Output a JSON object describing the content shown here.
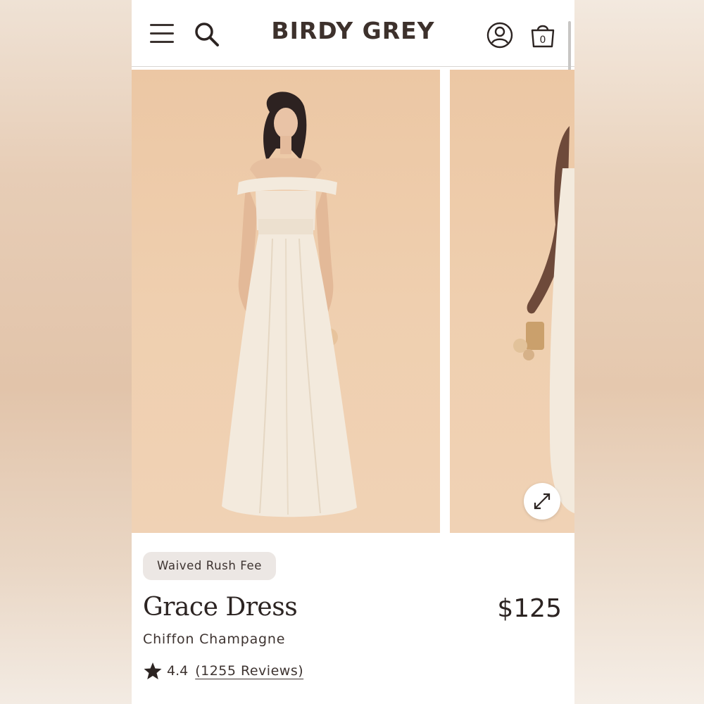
{
  "header": {
    "brand": "BIRDY GREY",
    "icons": [
      "menu-icon",
      "search-icon",
      "account-icon",
      "shopping-bag-icon"
    ],
    "bag_count": "0"
  },
  "gallery": {
    "images": [
      "model in off-shoulder champagne gown",
      "side view of model holding clutch"
    ],
    "expand_icon": "expand-icon"
  },
  "product": {
    "badge": "Waived Rush Fee",
    "name": "Grace Dress",
    "price": "$125",
    "color": "Chiffon Champagne",
    "rating": "4.4",
    "reviews_label": "(1255 Reviews)"
  },
  "colors": {
    "text": "#2c2422",
    "brand": "#3d312c",
    "backdrop": "#ecc7a4",
    "dress": "#f3eadd",
    "badge_bg": "#ece7e4"
  }
}
